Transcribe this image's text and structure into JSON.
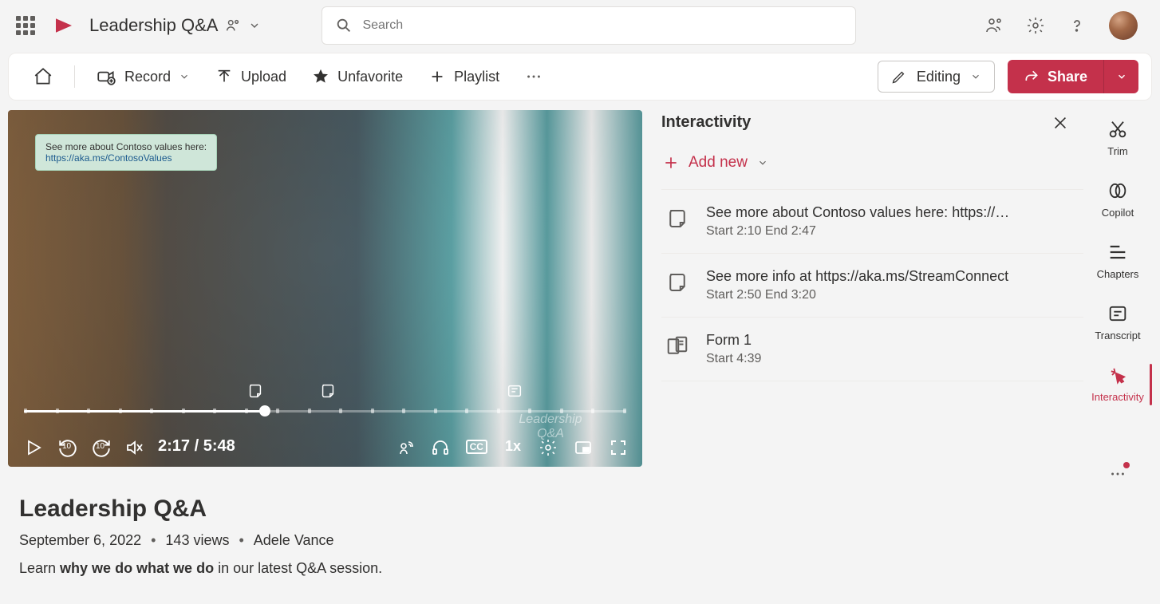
{
  "header": {
    "title": "Leadership Q&A",
    "search_placeholder": "Search"
  },
  "actionbar": {
    "record": "Record",
    "upload": "Upload",
    "unfavorite": "Unfavorite",
    "playlist": "Playlist",
    "editing": "Editing",
    "share": "Share"
  },
  "video": {
    "callout_text": "See more about Contoso values here:",
    "callout_link": "https://aka.ms/ContosoValues",
    "time_current": "2:17",
    "time_total": "5:48",
    "speed": "1x",
    "skip_back": "10",
    "skip_fwd": "10",
    "watermark": "Leadership Q&A"
  },
  "panel": {
    "title": "Interactivity",
    "add_new": "Add new",
    "items": [
      {
        "title": "See more about Contoso values here: https://…",
        "sub": "Start 2:10 End 2:47",
        "type": "note"
      },
      {
        "title": "See more info at https://aka.ms/StreamConnect",
        "sub": "Start 2:50 End 3:20",
        "type": "note"
      },
      {
        "title": "Form 1",
        "sub": "Start 4:39",
        "type": "form"
      }
    ]
  },
  "rail": {
    "trim": "Trim",
    "copilot": "Copilot",
    "chapters": "Chapters",
    "transcript": "Transcript",
    "interactivity": "Interactivity"
  },
  "meta": {
    "title": "Leadership Q&A",
    "date": "September 6, 2022",
    "views": "143 views",
    "author": "Adele Vance",
    "desc_pre": "Learn ",
    "desc_bold": "why we do what we do",
    "desc_post": " in our latest Q&A session."
  }
}
